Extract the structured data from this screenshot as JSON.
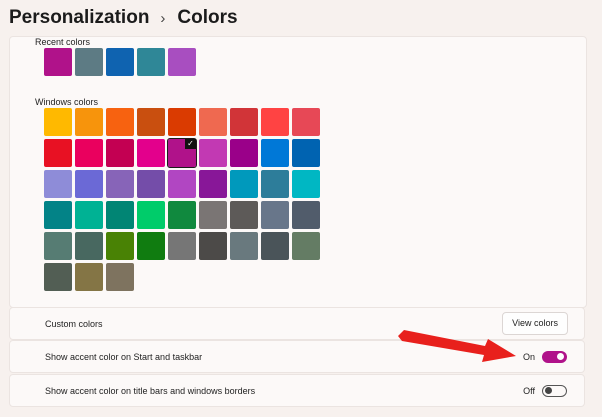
{
  "breadcrumb": {
    "parent": "Personalization",
    "current": "Colors"
  },
  "recent_colors": {
    "label": "Recent colors",
    "swatches": [
      "#b0128a",
      "#5d7b84",
      "#0f63b0",
      "#2f8797",
      "#a84ec0"
    ]
  },
  "windows_colors": {
    "label": "Windows colors",
    "selected": "#b0128a",
    "rows": [
      [
        "#ffb900",
        "#f7940c",
        "#f76210",
        "#c94f0f",
        "#da3b01",
        "#ef6950",
        "#d13438",
        "#ff4343",
        "#e74856"
      ],
      [
        "#e81123",
        "#ea005e",
        "#c30052",
        "#e3008c",
        "#b0128a",
        "#c239b3",
        "#9a0089",
        "#0078d7",
        "#0063b1"
      ],
      [
        "#8e8cd8",
        "#6b69d6",
        "#8764b8",
        "#744da9",
        "#b146c2",
        "#881798",
        "#0099bc",
        "#2d7d9a",
        "#00b7c3"
      ],
      [
        "#038387",
        "#00b294",
        "#018574",
        "#00cc6a",
        "#10893e",
        "#7a7574",
        "#5d5a58",
        "#68768a",
        "#515c6b"
      ],
      [
        "#567c73",
        "#486860",
        "#498205",
        "#107c10",
        "#767676",
        "#4c4a48",
        "#69797e",
        "#4a5459",
        "#647c64"
      ],
      [
        "#525e54",
        "#847545",
        "#7e735f"
      ]
    ]
  },
  "custom_colors": {
    "label": "Custom colors",
    "button": "View colors"
  },
  "accent_start": {
    "label": "Show accent color on Start and taskbar",
    "state": "On",
    "on": true
  },
  "accent_title": {
    "label": "Show accent color on title bars and windows borders",
    "state": "Off",
    "on": false
  },
  "annotation": {
    "arrow_color": "#e8201c"
  }
}
